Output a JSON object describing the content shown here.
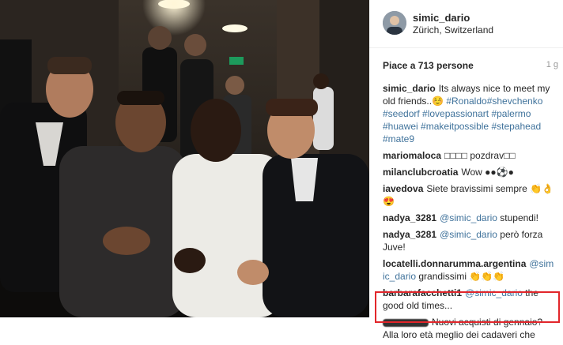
{
  "post": {
    "username": "simic_dario",
    "location": "Zürich, Switzerland",
    "likes": "Piace a 713 persone",
    "time": "1 g"
  },
  "comments": [
    {
      "user": "simic_dario",
      "parts": [
        {
          "t": "text",
          "v": "Its always nice to meet my old friends..☺️ "
        },
        {
          "t": "tag",
          "v": "#Ronaldo"
        },
        {
          "t": "tag",
          "v": "#shevchenko"
        },
        {
          "t": "text",
          "v": " "
        },
        {
          "t": "tag",
          "v": "#seedorf"
        },
        {
          "t": "text",
          "v": " "
        },
        {
          "t": "tag",
          "v": "#lovepassionart"
        },
        {
          "t": "text",
          "v": " "
        },
        {
          "t": "tag",
          "v": "#palermo"
        },
        {
          "t": "text",
          "v": " "
        },
        {
          "t": "tag",
          "v": "#huawei"
        },
        {
          "t": "text",
          "v": " "
        },
        {
          "t": "tag",
          "v": "#makeitpossible"
        },
        {
          "t": "text",
          "v": " "
        },
        {
          "t": "tag",
          "v": "#stepahead"
        },
        {
          "t": "text",
          "v": " "
        },
        {
          "t": "tag",
          "v": "#mate9"
        }
      ]
    },
    {
      "user": "marioma​loca",
      "parts": [
        {
          "t": "text",
          "v": "□□□□ pozdrav□□"
        }
      ]
    },
    {
      "user": "milanclubcroatia",
      "parts": [
        {
          "t": "text",
          "v": "Wow ●●⚽●"
        }
      ]
    },
    {
      "user": "iavedova",
      "parts": [
        {
          "t": "text",
          "v": "Siete bravissimi sempre 👏👌 😍"
        }
      ]
    },
    {
      "user": "nadya_3281",
      "parts": [
        {
          "t": "mention",
          "v": "@simic_dario"
        },
        {
          "t": "text",
          "v": " stupendi!"
        }
      ]
    },
    {
      "user": "nadya_3281",
      "parts": [
        {
          "t": "mention",
          "v": "@simic_dario"
        },
        {
          "t": "text",
          "v": " però forza Juve!"
        }
      ]
    },
    {
      "user": "locatelli.donnarumma.argentina",
      "parts": [
        {
          "t": "mention",
          "v": "@simic_dario"
        },
        {
          "t": "text",
          "v": " grandissimi 👏👏👏"
        }
      ]
    },
    {
      "user": "barbarafacchetti1",
      "parts": [
        {
          "t": "mention",
          "v": "@simic_dario"
        },
        {
          "t": "text",
          "v": " the good old times..."
        }
      ]
    },
    {
      "user": "",
      "redacted": true,
      "parts": [
        {
          "t": "text",
          "v": "Nuovi acquisti di gennaio? Alla loro età meglio dei cadaveri che"
        }
      ]
    }
  ]
}
